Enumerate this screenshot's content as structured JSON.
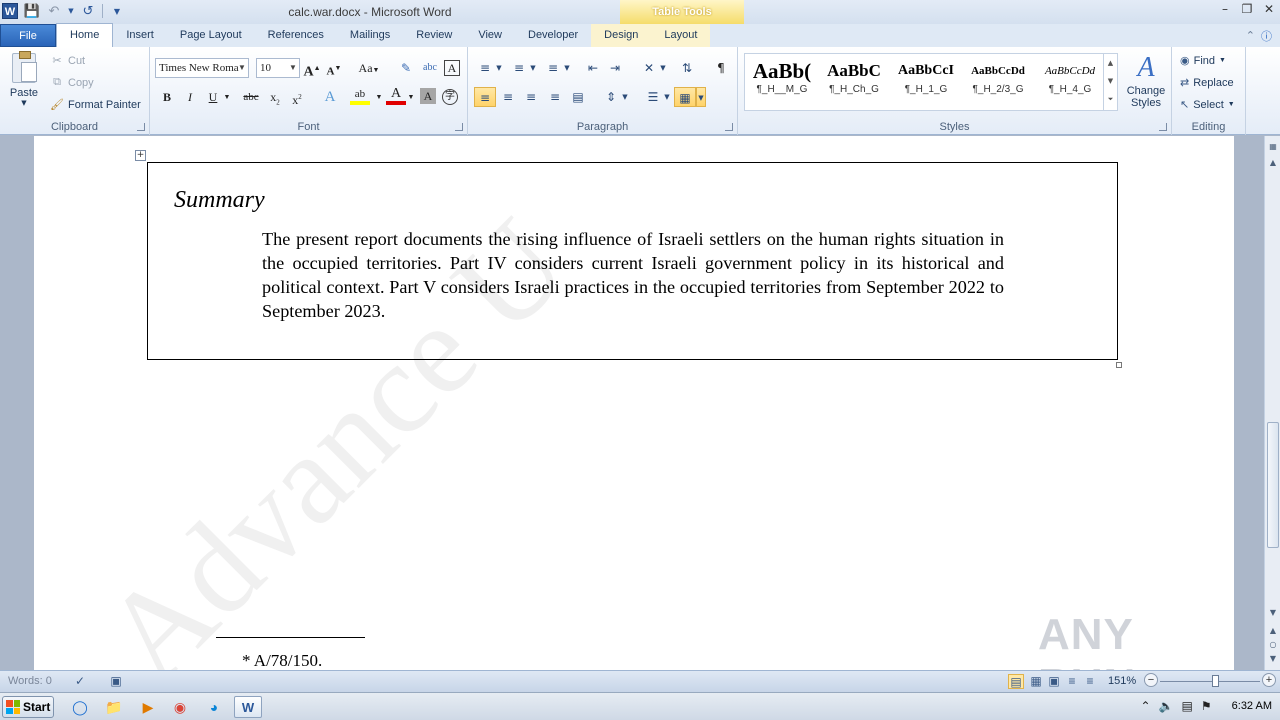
{
  "window": {
    "title": "calc.war.docx - Microsoft Word",
    "context_tab_header": "Table Tools"
  },
  "tabs": [
    "File",
    "Home",
    "Insert",
    "Page Layout",
    "References",
    "Mailings",
    "Review",
    "View",
    "Developer",
    "Design",
    "Layout"
  ],
  "active_tab": "Home",
  "ribbon": {
    "clipboard": {
      "label": "Clipboard",
      "paste": "Paste",
      "cut": "Cut",
      "copy": "Copy",
      "format_painter": "Format Painter"
    },
    "font": {
      "label": "Font",
      "font_name": "Times New Roma",
      "font_size": "10"
    },
    "paragraph": {
      "label": "Paragraph"
    },
    "styles": {
      "label": "Styles",
      "items": [
        {
          "sample": "AaBb(",
          "name": "¶_H__M_G"
        },
        {
          "sample": "AaBbC",
          "name": "¶_H_Ch_G"
        },
        {
          "sample": "AaBbCcI",
          "name": "¶_H_1_G"
        },
        {
          "sample": "AaBbCcDd",
          "name": "¶_H_2/3_G"
        },
        {
          "sample": "AaBbCcDd",
          "name": "¶_H_4_G"
        }
      ],
      "change_styles": "Change Styles"
    },
    "editing": {
      "label": "Editing",
      "find": "Find",
      "replace": "Replace",
      "select": "Select"
    }
  },
  "document": {
    "summary_title": "Summary",
    "summary_text": "The present report documents the rising influence of Israeli settlers on the human rights situation in the occupied territories. Part IV considers current Israeli government policy in its historical and political context. Part V considers Israeli practices in the occupied territories from September 2022 to September 2023.",
    "footnote": "*  A/78/150.",
    "watermark": "Advance U",
    "overlay_brand": "ANY RUN"
  },
  "statusbar": {
    "words": "Words: 0",
    "zoom": "151%"
  },
  "taskbar": {
    "start": "Start",
    "time": "6:32 AM"
  }
}
